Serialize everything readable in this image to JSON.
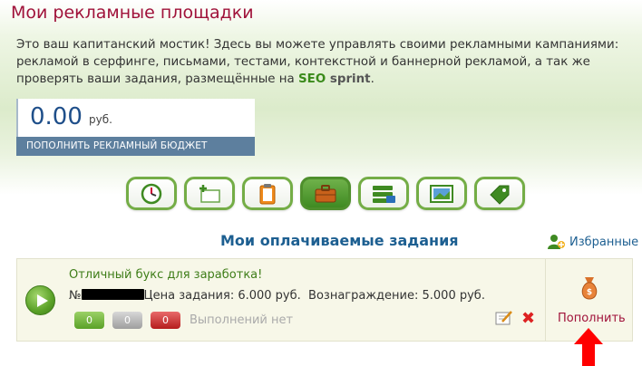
{
  "page": {
    "title": "Мои рекламные площадки",
    "intro_text": "Это ваш капитанский мостик! Здесь вы можете управлять своими рекламными кампаниями: рекламой в серфинге, письмами, тестами, контекстной и баннерной рекламой, а так же проверять ваши задания, размещённые на ",
    "brand_seo": "SEO",
    "brand_sprint": "sprint",
    "intro_end": "."
  },
  "balance": {
    "amount": "0.00",
    "currency": "руб.",
    "topup_label": "ПОПОЛНИТЬ РЕКЛАМНЫЙ БЮДЖЕТ"
  },
  "toolbar": {
    "icons": [
      "clock-icon",
      "add-icon",
      "clipboard-icon",
      "briefcase-icon",
      "list-icon",
      "banner-icon",
      "tag-icon"
    ],
    "active_index": 3
  },
  "tasks_section": {
    "title": "Мои оплачиваемые задания",
    "favorites_label": "Избранные"
  },
  "task": {
    "title": "Отличный букс для заработка!",
    "number_prefix": "№",
    "price_text": "Цена задания: 6.000 руб.",
    "reward_text": "Вознаграждение: 5.000 руб.",
    "counter_green": "0",
    "counter_gray": "0",
    "counter_red": "0",
    "status_text": "Выполнений нет",
    "topup_label": "Пополнить"
  },
  "colors": {
    "accent_green": "#5aa127",
    "title_red": "#a0123a",
    "heading_blue": "#1d5f91",
    "arrow_red": "#ff0000"
  }
}
